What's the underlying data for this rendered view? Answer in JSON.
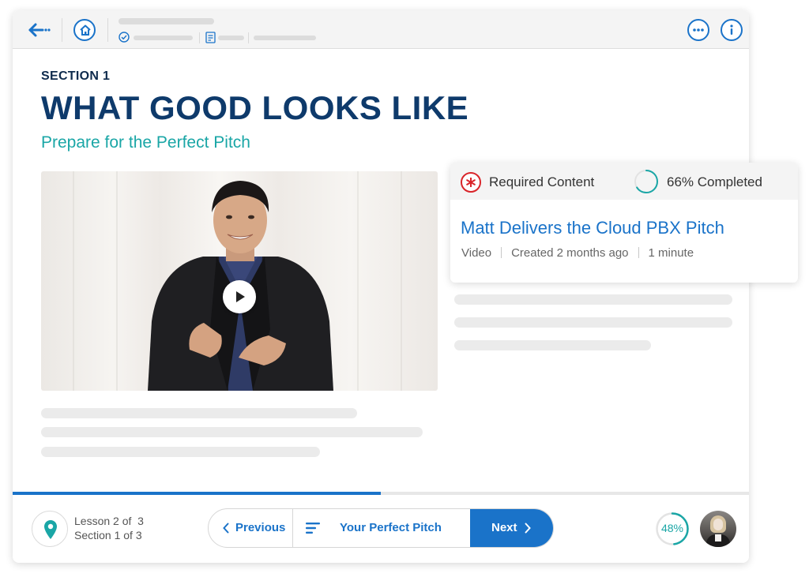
{
  "header": {
    "back_icon": "arrow-left-icon",
    "home_icon": "home-icon",
    "more_icon": "ellipsis-icon",
    "info_icon": "info-icon"
  },
  "content": {
    "section_label": "SECTION 1",
    "title": "WHAT GOOD LOOKS LIKE",
    "subtitle": "Prepare for the Perfect Pitch"
  },
  "card": {
    "required_label": "Required Content",
    "completed_label": "66% Completed",
    "completed_fraction": 0.66,
    "item_title": "Matt Delivers the Cloud PBX Pitch",
    "meta": [
      "Video",
      "Created 2 months ago",
      "1 minute"
    ]
  },
  "footer": {
    "lesson": "Lesson 2 of  3",
    "section": "Section 1 of 3",
    "previous_label": "Previous",
    "menu_label": "Your Perfect Pitch",
    "next_label": "Next",
    "progress_percent": "48%",
    "progress_fraction": 0.48,
    "course_progress_fraction": 0.5
  },
  "colors": {
    "accent_blue": "#1a73c9",
    "title_navy": "#0e3a6b",
    "teal": "#1aa6a6",
    "required_red": "#d9252a"
  }
}
